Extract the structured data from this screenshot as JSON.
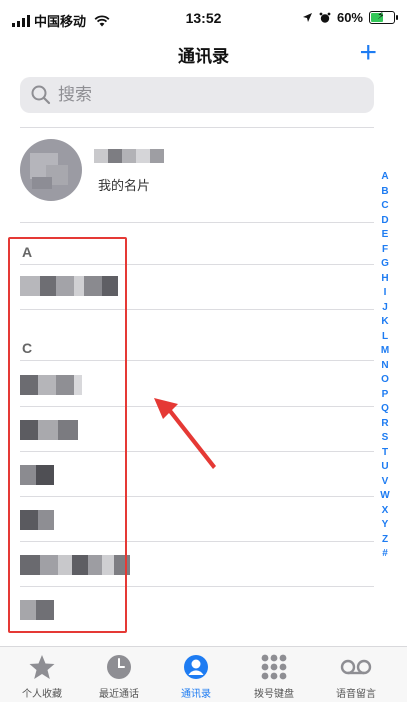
{
  "status_bar": {
    "carrier": "中国移动",
    "time": "13:52",
    "battery": "60%",
    "battery_level": 0.6,
    "icons": [
      "signal-icon",
      "wifi-icon",
      "location-icon",
      "alarm-icon",
      "battery-icon"
    ]
  },
  "nav": {
    "title": "通讯录",
    "add_icon": "+"
  },
  "search": {
    "placeholder": "搜索"
  },
  "my_card": {
    "subtitle": "我的名片"
  },
  "sections": [
    {
      "letter": "A"
    },
    {
      "letter": "C"
    }
  ],
  "index_letters": [
    "A",
    "B",
    "C",
    "D",
    "E",
    "F",
    "G",
    "H",
    "I",
    "J",
    "K",
    "L",
    "M",
    "N",
    "O",
    "P",
    "Q",
    "R",
    "S",
    "T",
    "U",
    "V",
    "W",
    "X",
    "Y",
    "Z",
    "#"
  ],
  "tabs": [
    {
      "label": "个人收藏",
      "icon": "star-icon",
      "active": false
    },
    {
      "label": "最近通话",
      "icon": "clock-icon",
      "active": false
    },
    {
      "label": "通讯录",
      "icon": "contacts-icon",
      "active": true
    },
    {
      "label": "拨号键盘",
      "icon": "keypad-icon",
      "active": false
    },
    {
      "label": "语音留言",
      "icon": "voicemail-icon",
      "active": false
    }
  ],
  "colors": {
    "accent": "#1e7cf2",
    "annotation": "#e53935"
  }
}
